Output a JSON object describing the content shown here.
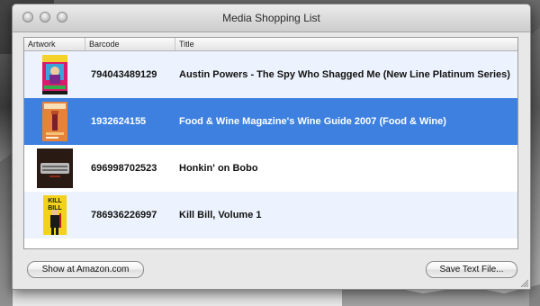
{
  "window": {
    "title": "Media Shopping List"
  },
  "table": {
    "columns": [
      "Artwork",
      "Barcode",
      "Title"
    ],
    "rows": [
      {
        "barcode": "794043489129",
        "title": "Austin Powers - The Spy Who Shagged Me (New Line Platinum Series)",
        "selected": false
      },
      {
        "barcode": "1932624155",
        "title": "Food & Wine Magazine's Wine Guide 2007 (Food & Wine)",
        "selected": true
      },
      {
        "barcode": "696998702523",
        "title": "Honkin' on Bobo",
        "selected": false
      },
      {
        "barcode": "786936226997",
        "title": "Kill Bill, Volume 1",
        "selected": false
      }
    ],
    "artwork_text": {
      "kill_bill": "KILL BILL"
    }
  },
  "buttons": {
    "amazon": "Show at Amazon.com",
    "save": "Save Text File..."
  },
  "colors": {
    "selection": "#3d80df",
    "alt_row": "#edf3fe"
  }
}
